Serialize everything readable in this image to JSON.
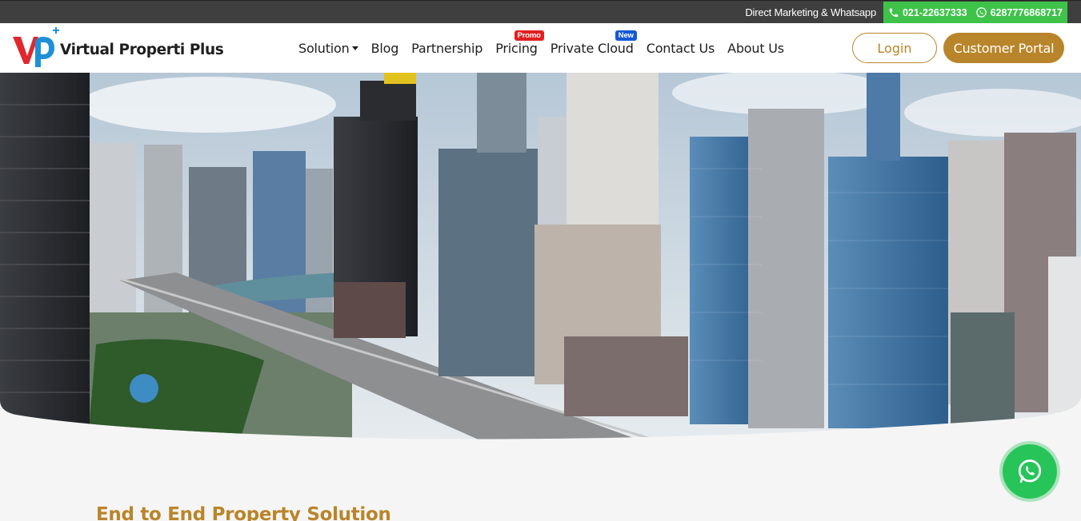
{
  "topbar": {
    "text": "Direct Marketing & Whatsapp",
    "phone": "021-22637333",
    "whatsapp": "6287776868717",
    "accent": "#3ec24a"
  },
  "header": {
    "logo_text": "Virtual Properti Plus",
    "logo_icon": "vp-logo-icon",
    "nav": [
      {
        "label": "Solution",
        "has_dropdown": true
      },
      {
        "label": "Blog"
      },
      {
        "label": "Partnership"
      },
      {
        "label": "Pricing",
        "badge": "Promo"
      },
      {
        "label": "Private Cloud",
        "badge": "New"
      },
      {
        "label": "Contact Us"
      },
      {
        "label": "About Us"
      }
    ],
    "login_label": "Login",
    "portal_label": "Customer Portal",
    "brand_color": "#b9852a"
  },
  "hero": {
    "image": "city-skyline-photo"
  },
  "section": {
    "title": "End to End Property Solution"
  },
  "floating": {
    "icon": "whatsapp-icon",
    "color": "#27c45a"
  }
}
